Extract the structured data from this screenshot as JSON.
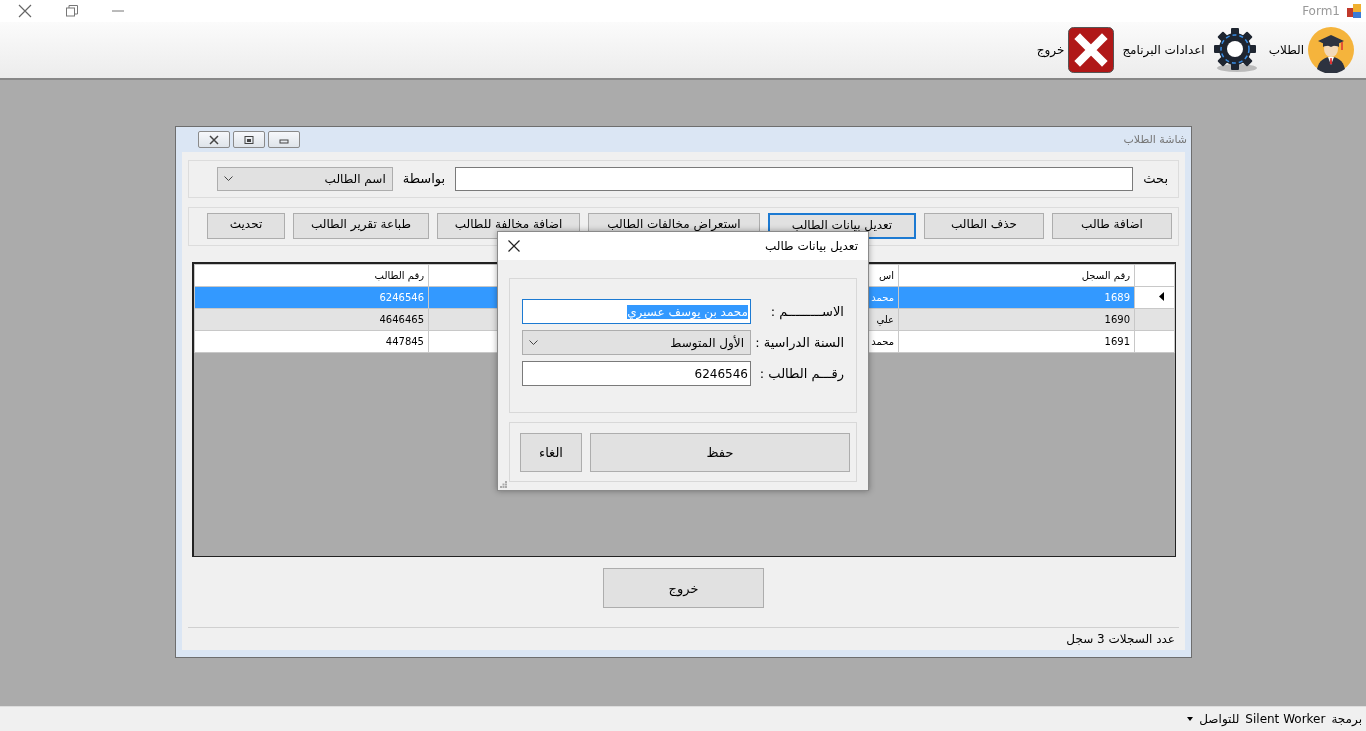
{
  "app_window": {
    "title": "Form1"
  },
  "toolbar": [
    {
      "label": "الطلاب",
      "kind": "students"
    },
    {
      "label": "اعدادات البرنامج",
      "kind": "settings"
    },
    {
      "label": "خروج",
      "kind": "exit"
    }
  ],
  "child_window": {
    "title": "شاشة الطلاب",
    "search": {
      "label": "بحث",
      "by_label": "بواسطة",
      "by_value": "اسم الطالب"
    },
    "buttons": [
      {
        "label": "اضافة طالب",
        "focused": false
      },
      {
        "label": "حذف الطالب",
        "focused": false
      },
      {
        "label": "تعديل بيانات الطالب",
        "focused": true
      },
      {
        "label": "استعراض مخالفات الطالب",
        "focused": false
      },
      {
        "label": "اضافة مخالفة للطالب",
        "focused": false
      },
      {
        "label": "طباعة تقرير الطالب",
        "focused": false
      },
      {
        "label": "تحديث",
        "focused": false
      }
    ],
    "table": {
      "columns": [
        "رقم السجل",
        "اس",
        "رقم الطالب"
      ],
      "rows": [
        {
          "selected": true,
          "cells": [
            "1689",
            "محمد",
            "6246546"
          ]
        },
        {
          "selected": false,
          "cells": [
            "1690",
            "علي",
            "4646465"
          ]
        },
        {
          "selected": false,
          "cells": [
            "1691",
            "محمد",
            "447845"
          ]
        }
      ]
    },
    "exit_button": "خروج",
    "status": "عدد السجلات 3 سجل"
  },
  "dialog": {
    "title": "تعديل بيانات طالب",
    "fields": [
      {
        "label": "الاســـــــــم :",
        "kind": "text",
        "value": "محمد بن يوسف عسيري",
        "text_selected": true
      },
      {
        "label": "السنة الدراسية :",
        "kind": "dropdown",
        "value": "الأول المتوسط"
      },
      {
        "label": "رقـــم الطالب :",
        "kind": "text",
        "value": "6246546",
        "text_selected": false
      }
    ],
    "buttons": [
      "حفظ",
      "الغاء"
    ]
  },
  "status_bar": {
    "items": [
      "برمجة",
      "Silent Worker",
      "للتواصل"
    ]
  }
}
